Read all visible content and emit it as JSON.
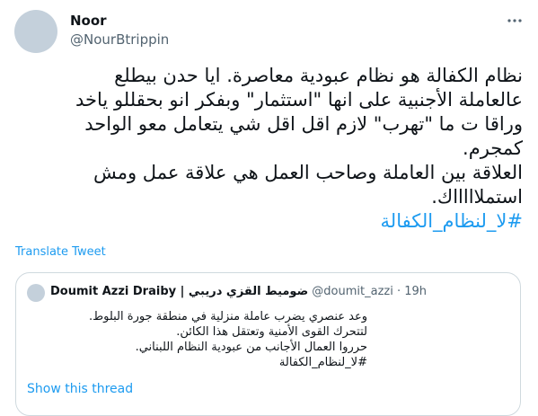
{
  "author": {
    "name": "Noor",
    "handle": "@NourBtrippin"
  },
  "tweet": {
    "lines": [
      "نظام الكفالة هو نظام عبودية معاصرة. ايا حدن  بيطلع",
      "عالعاملة الأجنبية على انها \"استثمار\" وبفكر انو بحقللو ياخد",
      "وراقا ت ما \"تهرب\" لازم اقل اقل شي يتعامل معو الواحد",
      "كمجرم.",
      "العلاقة بين العاملة وصاحب العمل هي علاقة عمل ومش",
      "استملاااااك."
    ],
    "hashtag": "#لا_لنظام_الكفالة"
  },
  "translate_label": "Translate Tweet",
  "quoted_tweet": {
    "name": "Doumit Azzi Draiby | ضوميط القزي دريبي",
    "handle": "@doumit_azzi",
    "separator": "·",
    "time": "19h",
    "lines": [
      "وعد عنصري يضرب عاملة منزلية في منطقة جورة البلوط.",
      "لتتحرك القوى الأمنية وتعتقل هذا الكائن.",
      "حرروا العمال الأجانب من عبودية النظام اللبناني.",
      "#لا_لنظام_الكفالة"
    ]
  },
  "show_thread_label": "Show this thread",
  "icons": {
    "more": "more-horizontal-icon"
  },
  "colors": {
    "link": "#1d9bf0",
    "secondary_text": "#536471",
    "border": "#cfd9de"
  }
}
